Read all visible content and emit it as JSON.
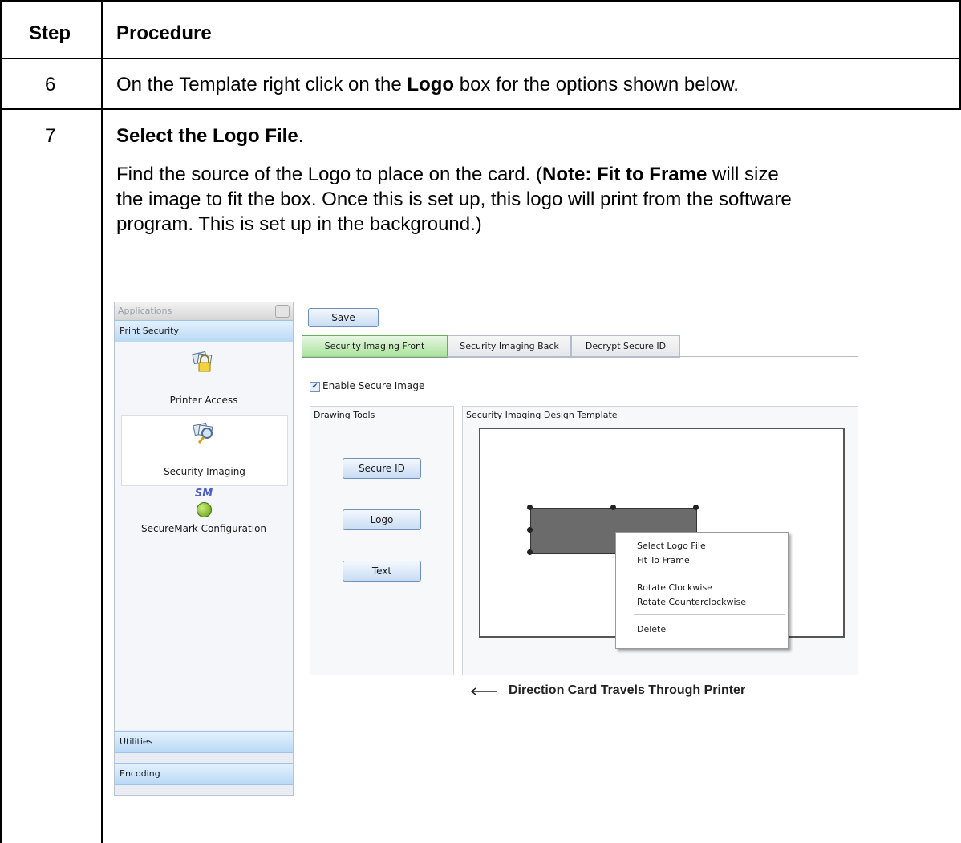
{
  "table": {
    "headers": {
      "step": "Step",
      "procedure": "Procedure"
    },
    "rows": [
      {
        "step": "6",
        "text_pre": "On the Template right click on the ",
        "text_bold": "Logo",
        "text_post": " box for the options shown below."
      },
      {
        "step": "7",
        "title_bold": "Select the Logo File",
        "title_post": ".",
        "para_line1_pre": "Find the source of the Logo to place on the card. (",
        "para_line1_bold": "Note:  Fit to Frame",
        "para_line1_post": " will size",
        "para_line2": "the image to fit the box. Once this is set up, this logo will print from the software",
        "para_line3": "program. This is set up in the background.)"
      }
    ]
  },
  "screenshot": {
    "app_panel": {
      "header": "Applications",
      "section": "Print Security",
      "items": [
        {
          "label": "Printer Access",
          "icon": "padlock-cards-icon"
        },
        {
          "label": "Security Imaging",
          "icon": "magnifier-cards-icon"
        },
        {
          "label": "SecureMark Configuration",
          "icon": "securemark-icon",
          "icon_text": "SM"
        }
      ],
      "bottom_sections": [
        "Utilities",
        "Encoding"
      ]
    },
    "save_button": "Save",
    "tabs": [
      "Security Imaging Front",
      "Security Imaging Back",
      "Decrypt Secure ID"
    ],
    "enable_checkbox": {
      "label": "Enable Secure Image",
      "checked": true,
      "mark": "✔"
    },
    "drawing_tools": {
      "title": "Drawing Tools",
      "buttons": [
        "Secure ID",
        "Logo",
        "Text"
      ]
    },
    "design_template": {
      "title": "Security Imaging Design Template"
    },
    "context_menu": {
      "items": [
        "Select Logo File",
        "Fit To Frame",
        "Rotate Clockwise",
        "Rotate Counterclockwise",
        "Delete"
      ]
    },
    "direction_text": "Direction Card Travels Through Printer",
    "colors": {
      "active_tab": "#a8e29a",
      "section_bar": "#b9d9f6",
      "logo_box": "#6b6b6b"
    }
  }
}
